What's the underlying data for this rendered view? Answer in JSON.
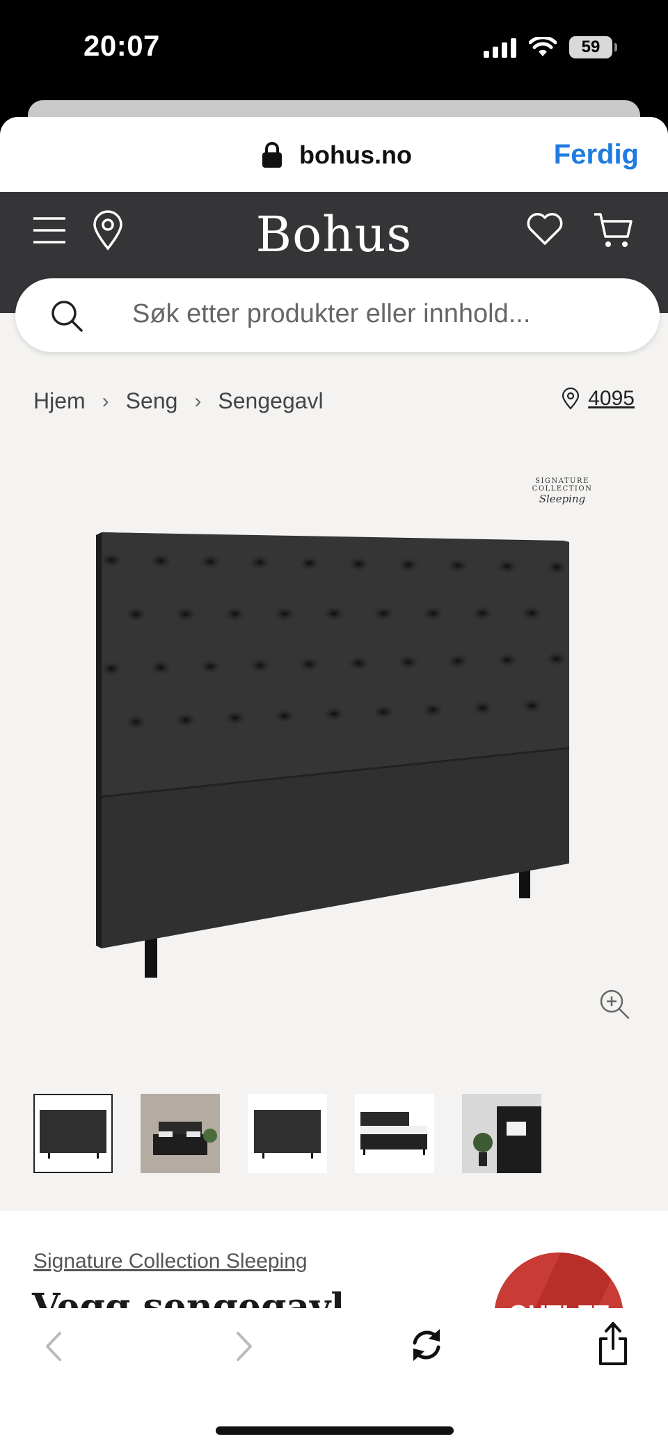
{
  "status_bar": {
    "time": "20:07",
    "battery": "59"
  },
  "browser": {
    "url": "bohus.no",
    "done_label": "Ferdig"
  },
  "header": {
    "logo": "Bohus"
  },
  "search": {
    "placeholder": "Søk etter produkter eller innhold..."
  },
  "breadcrumb": {
    "items": [
      "Hjem",
      "Seng",
      "Sengegavl"
    ]
  },
  "store": {
    "number": "4095"
  },
  "gallery": {
    "brand_mark_line1": "SIGNATURE COLLECTION",
    "brand_mark_line2": "Sleeping",
    "thumbnails": 5,
    "active_index": 0
  },
  "product": {
    "brand": "Signature Collection Sleeping",
    "title": "Vegg sengegavl",
    "badge": "OUTLET"
  },
  "colors": {
    "header_bg": "#353538",
    "page_bg": "#f4f3f1",
    "accent_blue": "#1e7be0",
    "outlet_red": "#c93b35"
  }
}
